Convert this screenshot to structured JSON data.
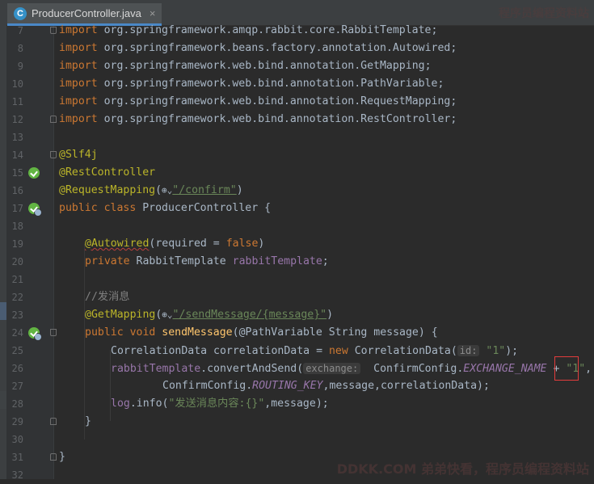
{
  "editor": {
    "tab": {
      "icon": "C",
      "label": "ProducerController.java",
      "close": "×"
    },
    "watermark": "DDKK.COM 弟弟快看，程序员编程资料站",
    "watermark_top": "程序员编程资料站",
    "colors": {
      "keyword": "#cc7832",
      "annotation": "#bbb529",
      "string": "#6a8759",
      "field": "#9876aa",
      "method": "#ffc66d",
      "comment": "#808080",
      "text": "#a9b7c6",
      "highlight_box": "#e23c3c"
    },
    "lines": [
      {
        "n": "7",
        "t": {
          "kw": "import",
          "p": " org.springframework.amqp.rabbit.core.",
          "c": "RabbitTemplate",
          "e": ";"
        }
      },
      {
        "n": "8",
        "t": {
          "kw": "import",
          "p": " org.springframework.beans.factory.annotation.",
          "c": "Autowired",
          "e": ";"
        }
      },
      {
        "n": "9",
        "t": {
          "kw": "import",
          "p": " org.springframework.web.bind.annotation.",
          "c": "GetMapping",
          "e": ";"
        }
      },
      {
        "n": "10",
        "t": {
          "kw": "import",
          "p": " org.springframework.web.bind.annotation.",
          "c": "PathVariable",
          "e": ";"
        }
      },
      {
        "n": "11",
        "t": {
          "kw": "import",
          "p": " org.springframework.web.bind.annotation.",
          "c": "RequestMapping",
          "e": ";"
        }
      },
      {
        "n": "12",
        "t": {
          "kw": "import",
          "p": " org.springframework.web.bind.annotation.",
          "c": "RestController",
          "e": ";"
        }
      },
      {
        "n": "13"
      },
      {
        "n": "14",
        "t": {
          "a": "@Slf4j"
        }
      },
      {
        "n": "15",
        "t": {
          "a": "@RestController"
        }
      },
      {
        "n": "16",
        "t": {
          "a": "@RequestMapping",
          "o": "(",
          "s": "\"/confirm\"",
          "cl": ")"
        }
      },
      {
        "n": "17",
        "t": {
          "kw": "public class",
          "p": " ProducerController {"
        }
      },
      {
        "n": "18"
      },
      {
        "n": "19",
        "t": {
          "a": "@Autowired",
          "o": "(required = ",
          "kw2": "false",
          "cl": ")"
        }
      },
      {
        "n": "20",
        "t": {
          "kw": "private",
          "p": " RabbitTemplate ",
          "f": "rabbitTemplate",
          "e": ";"
        }
      },
      {
        "n": "21"
      },
      {
        "n": "22",
        "t": {
          "cm": "//发消息"
        }
      },
      {
        "n": "23",
        "t": {
          "a": "@GetMapping",
          "o": "(",
          "s": "\"/sendMessage/{message}\"",
          "cl": ")"
        }
      },
      {
        "n": "24",
        "t": {
          "kw": "public void",
          "fn": " sendMessage",
          "p": "(@PathVariable String message) {"
        }
      },
      {
        "n": "25",
        "t": {
          "p": "CorrelationData correlationData = ",
          "kw": "new",
          "p2": " CorrelationData(",
          "hint": "id:",
          "s": "\"1\"",
          "e": ");"
        }
      },
      {
        "n": "26",
        "t": {
          "f": "rabbitTemplate",
          "p": ".convertAndSend(",
          "hint": "exchange:",
          "p2": " ConfirmConfig.",
          "sf": "EXCHANGE_NAME",
          "p3": " + ",
          "s": "\"1\"",
          "e": ","
        }
      },
      {
        "n": "27",
        "t": {
          "p": "ConfirmConfig.",
          "sf": "ROUTING_KEY",
          "p2": ",message,correlationData);"
        }
      },
      {
        "n": "28",
        "t": {
          "f": "log",
          "p": ".info(",
          "s": "\"发送消息内容:{}\"",
          "e": ",message);"
        }
      },
      {
        "n": "29",
        "t": {
          "p": "}"
        }
      },
      {
        "n": "30"
      },
      {
        "n": "31",
        "t": {
          "p": "}"
        }
      },
      {
        "n": "32"
      }
    ]
  }
}
